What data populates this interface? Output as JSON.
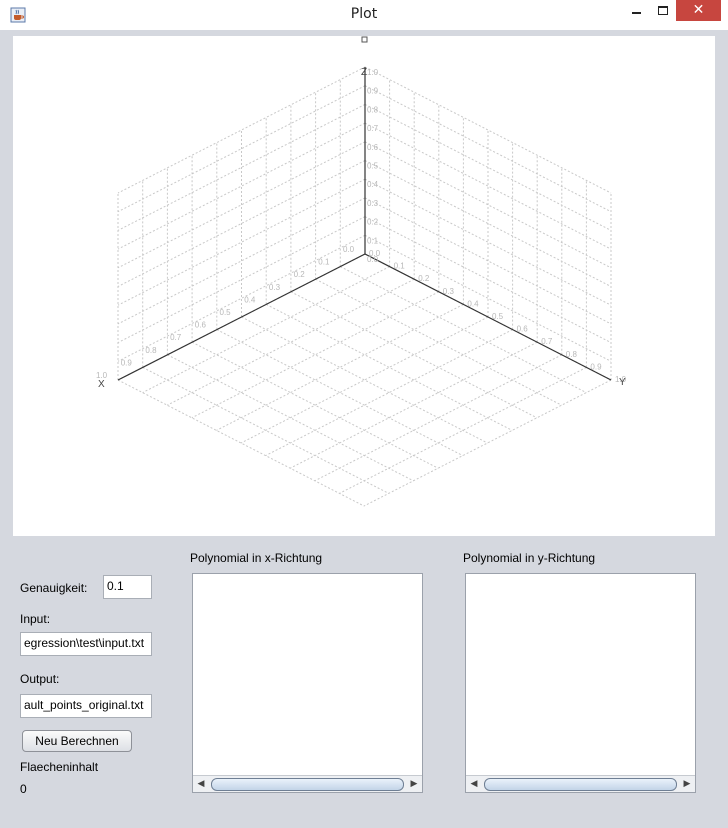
{
  "window": {
    "title": "Plot",
    "close_glyph": "✕"
  },
  "plot": {
    "type": "3d-surface-plot",
    "axes": {
      "x": "X",
      "y": "Y",
      "z": "Z"
    },
    "ticks": [
      "0.0",
      "0.1",
      "0.2",
      "0.3",
      "0.4",
      "0.5",
      "0.6",
      "0.7",
      "0.8",
      "0.9",
      "1.0"
    ],
    "ranges": {
      "x": [
        0,
        1
      ],
      "y": [
        0,
        1
      ],
      "z": [
        0,
        1
      ]
    },
    "grid": true
  },
  "controls": {
    "genauigkeit_label": "Genauigkeit:",
    "genauigkeit_value": "0.1",
    "input_label": "Input:",
    "input_value": "egression\\test\\input.txt",
    "output_label": "Output:",
    "output_value": "ault_points_original.txt",
    "recalc_button": "Neu Berechnen",
    "area_label": "Flaecheninhalt",
    "area_value": "0"
  },
  "panels": {
    "x_title": "Polynomial in x-Richtung",
    "y_title": "Polynomial in y-Richtung"
  },
  "icons": {
    "app": "java-cup-icon",
    "minimize": "minimize-icon",
    "maximize": "maximize-icon",
    "close": "close-icon",
    "scroll_left": "arrow-left-icon",
    "scroll_right": "arrow-right-icon"
  },
  "colors": {
    "close_button": "#c7463f",
    "window_bg": "#d5d8df",
    "grid": "#c8c8c8"
  }
}
